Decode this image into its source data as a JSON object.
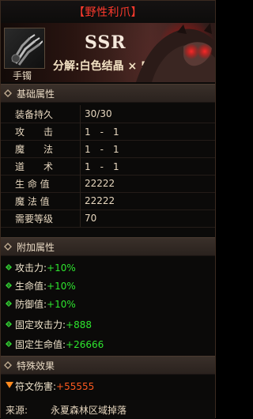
{
  "title": "【野性利爪】",
  "item": {
    "type": "手镯",
    "rarity": "SSR",
    "decompose": "分解:白色结晶 × 50"
  },
  "sections": {
    "base": "基础属性",
    "extra": "附加属性",
    "special": "特殊效果"
  },
  "base_stats": [
    {
      "key": "装备持久",
      "value": "30/30"
    },
    {
      "key": "攻　　击",
      "value": "1　-　1"
    },
    {
      "key": "魔　　法",
      "value": "1　-　1"
    },
    {
      "key": "道　　术",
      "value": "1　-　1"
    },
    {
      "key": "生 命 值",
      "value": "22222"
    },
    {
      "key": "魔 法 值",
      "value": "22222"
    },
    {
      "key": "需要等级",
      "value": "70"
    }
  ],
  "extra_stats": [
    {
      "name": "攻击力:",
      "value": "+10%"
    },
    {
      "name": "生命值:",
      "value": "+10%"
    },
    {
      "name": "防御值:",
      "value": "+10%"
    },
    {
      "name": "固定攻击力:",
      "value": "+888"
    },
    {
      "name": "固定生命值:",
      "value": "+26666"
    }
  ],
  "special_effects": [
    {
      "name": "符文伤害:",
      "value": "+55555"
    }
  ],
  "source": {
    "label": "来源:",
    "value": "永夏森林区域掉落"
  },
  "colors": {
    "title_red": "#ff3a2d",
    "green": "#2ee52e",
    "orange": "#ff5a1f"
  },
  "icons": {
    "item": "claw-bracelet-icon",
    "section": "diamond-icon",
    "attr": "green-gem-icon",
    "special": "down-arrow-icon"
  }
}
